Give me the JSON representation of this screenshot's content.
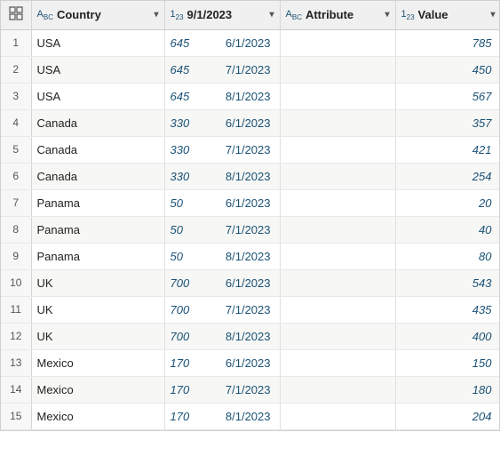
{
  "columns": [
    {
      "id": "index",
      "label": "",
      "type": "grid",
      "type_icon": "⊞"
    },
    {
      "id": "country",
      "label": "Country",
      "type": "abc",
      "type_icon": "ABC"
    },
    {
      "id": "date",
      "label": "9/1/2023",
      "type": "123",
      "type_icon": "123"
    },
    {
      "id": "attribute",
      "label": "Attribute",
      "type": "abc",
      "type_icon": "ABC"
    },
    {
      "id": "value",
      "label": "Value",
      "type": "123",
      "type_icon": "123"
    }
  ],
  "rows": [
    {
      "index": 1,
      "country": "USA",
      "date": "645",
      "date_display": "6/1/2023",
      "attribute": "",
      "value": "785"
    },
    {
      "index": 2,
      "country": "USA",
      "date": "645",
      "date_display": "7/1/2023",
      "attribute": "",
      "value": "450"
    },
    {
      "index": 3,
      "country": "USA",
      "date": "645",
      "date_display": "8/1/2023",
      "attribute": "",
      "value": "567"
    },
    {
      "index": 4,
      "country": "Canada",
      "date": "330",
      "date_display": "6/1/2023",
      "attribute": "",
      "value": "357"
    },
    {
      "index": 5,
      "country": "Canada",
      "date": "330",
      "date_display": "7/1/2023",
      "attribute": "",
      "value": "421"
    },
    {
      "index": 6,
      "country": "Canada",
      "date": "330",
      "date_display": "8/1/2023",
      "attribute": "",
      "value": "254"
    },
    {
      "index": 7,
      "country": "Panama",
      "date": "50",
      "date_display": "6/1/2023",
      "attribute": "",
      "value": "20"
    },
    {
      "index": 8,
      "country": "Panama",
      "date": "50",
      "date_display": "7/1/2023",
      "attribute": "",
      "value": "40"
    },
    {
      "index": 9,
      "country": "Panama",
      "date": "50",
      "date_display": "8/1/2023",
      "attribute": "",
      "value": "80"
    },
    {
      "index": 10,
      "country": "UK",
      "date": "700",
      "date_display": "6/1/2023",
      "attribute": "",
      "value": "543"
    },
    {
      "index": 11,
      "country": "UK",
      "date": "700",
      "date_display": "7/1/2023",
      "attribute": "",
      "value": "435"
    },
    {
      "index": 12,
      "country": "UK",
      "date": "700",
      "date_display": "8/1/2023",
      "attribute": "",
      "value": "400"
    },
    {
      "index": 13,
      "country": "Mexico",
      "date": "170",
      "date_display": "6/1/2023",
      "attribute": "",
      "value": "150"
    },
    {
      "index": 14,
      "country": "Mexico",
      "date": "170",
      "date_display": "7/1/2023",
      "attribute": "",
      "value": "180"
    },
    {
      "index": 15,
      "country": "Mexico",
      "date": "170",
      "date_display": "8/1/2023",
      "attribute": "",
      "value": "204"
    }
  ]
}
